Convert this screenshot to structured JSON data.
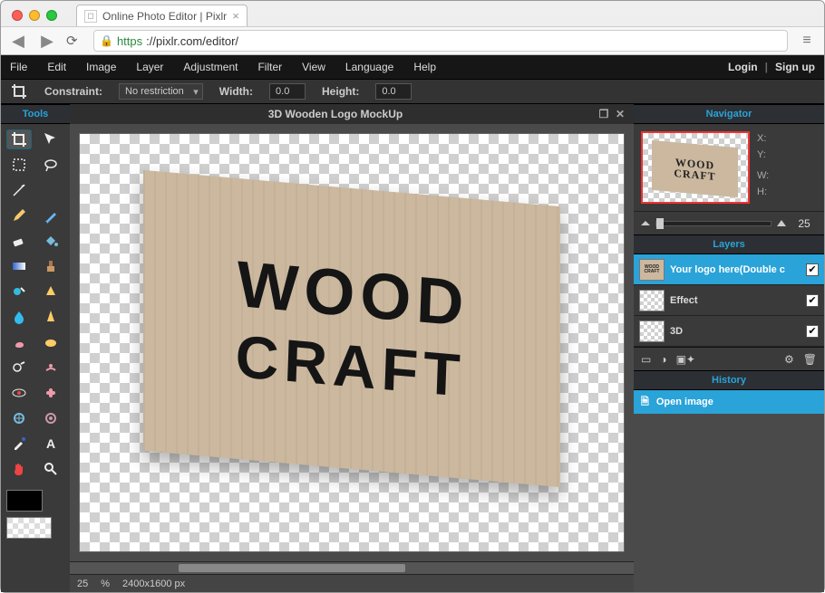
{
  "browser": {
    "tab_title": "Online Photo Editor | Pixlr",
    "url_https": "https",
    "url_rest": "://pixlr.com/editor/"
  },
  "menubar": {
    "items": [
      "File",
      "Edit",
      "Image",
      "Layer",
      "Adjustment",
      "Filter",
      "View",
      "Language",
      "Help"
    ],
    "login": "Login",
    "signup": "Sign up"
  },
  "optionbar": {
    "constraint_label": "Constraint:",
    "constraint_value": "No restriction",
    "width_label": "Width:",
    "width_value": "0.0",
    "height_label": "Height:",
    "height_value": "0.0"
  },
  "tools_title": "Tools",
  "document": {
    "title": "3D Wooden Logo MockUp",
    "logo_line1": "WOOD",
    "logo_line2": "CRAFT"
  },
  "status": {
    "zoom_pct": "25",
    "pct_sign": "%",
    "dimensions": "2400x1600 px"
  },
  "navigator": {
    "title": "Navigator",
    "labels": {
      "x": "X:",
      "y": "Y:",
      "w": "W:",
      "h": "H:"
    },
    "zoom": "25"
  },
  "layers": {
    "title": "Layers",
    "items": [
      {
        "name": "Your logo here(Double c",
        "checked": true,
        "active": true,
        "thumb": "wood"
      },
      {
        "name": "Effect",
        "checked": true,
        "active": false,
        "thumb": "checker"
      },
      {
        "name": "3D",
        "checked": true,
        "active": false,
        "thumb": "checker"
      }
    ]
  },
  "history": {
    "title": "History",
    "items": [
      {
        "name": "Open image",
        "active": true
      }
    ]
  }
}
